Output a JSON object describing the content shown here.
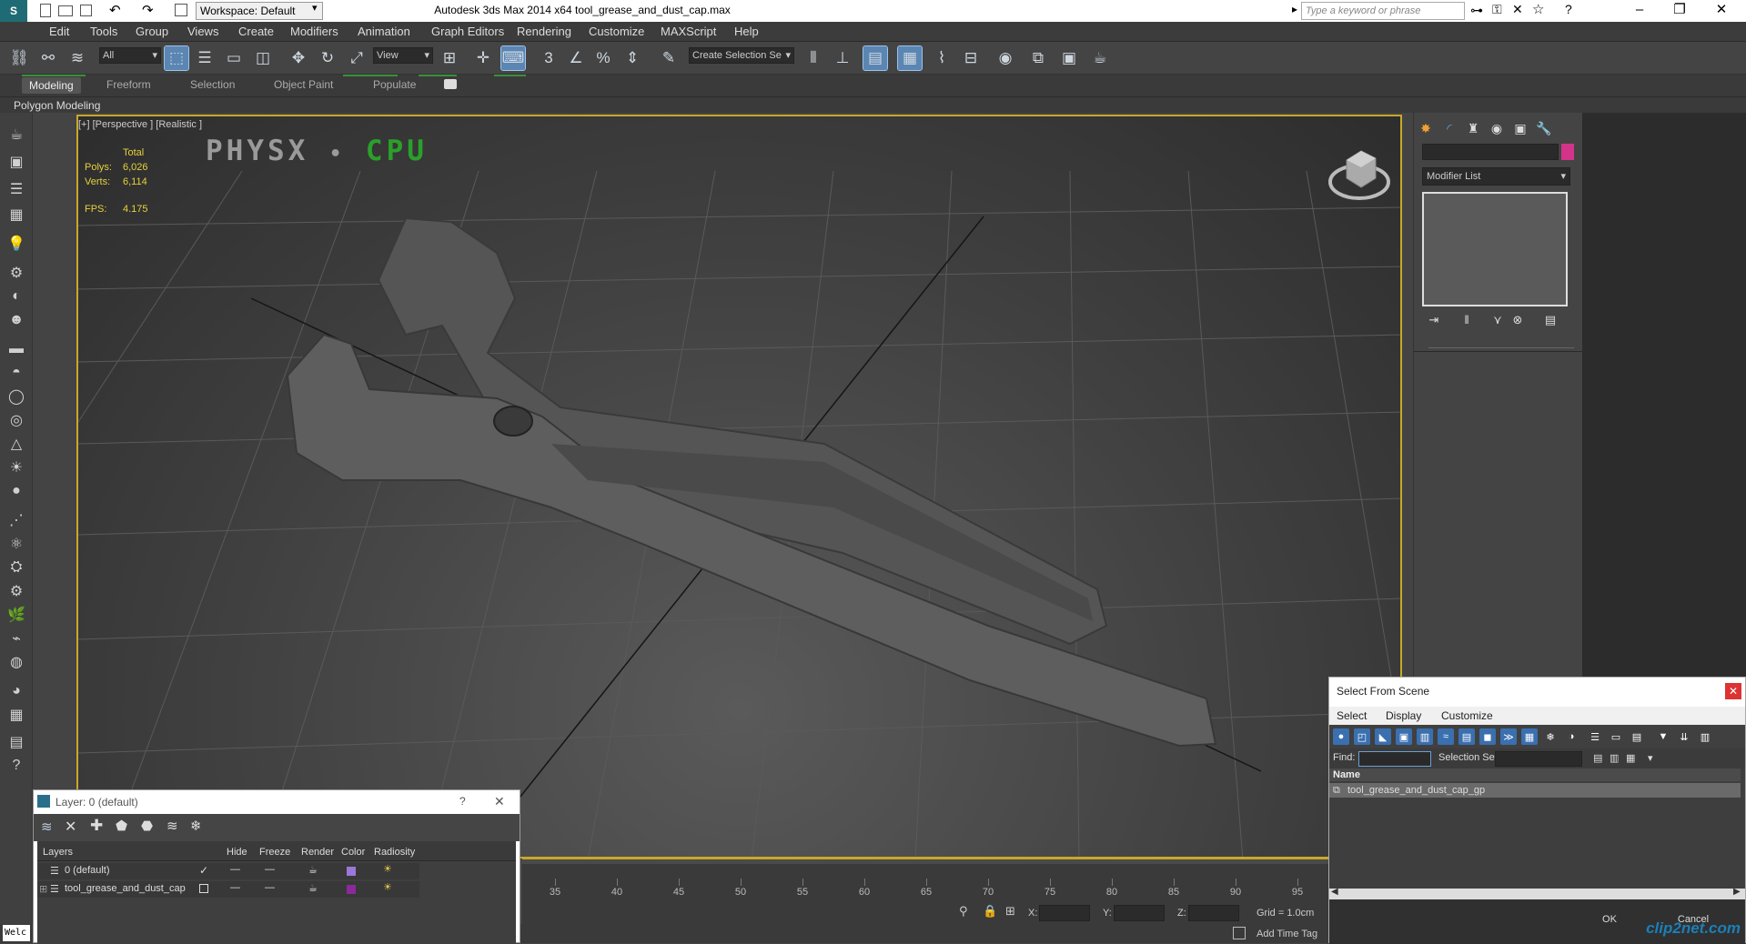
{
  "titlebar": {
    "workspace": "Workspace: Default",
    "app_title": "Autodesk 3ds Max  2014 x64     tool_grease_and_dust_cap.max",
    "search_placeholder": "Type a keyword or phrase"
  },
  "menu": [
    "Edit",
    "Tools",
    "Group",
    "Views",
    "Create",
    "Modifiers",
    "Animation",
    "Graph Editors",
    "Rendering",
    "Customize",
    "MAXScript",
    "Help"
  ],
  "toolbar": {
    "filter": "All",
    "refcoord": "View",
    "selset": "Create Selection Se",
    "snap_label": "3"
  },
  "ribbon": {
    "tabs": [
      "Modeling",
      "Freeform",
      "Selection",
      "Object Paint",
      "Populate"
    ],
    "panel": "Polygon Modeling"
  },
  "viewport": {
    "label": "[+] [Perspective ] [Realistic ]",
    "stats": {
      "total": "Total",
      "polys_label": "Polys:",
      "polys": "6,026",
      "verts_label": "Verts:",
      "verts": "6,114",
      "fps_label": "FPS:",
      "fps": "4.175"
    },
    "physx_a": "PHYSX",
    "physx_sep": "•",
    "physx_b": "CPU"
  },
  "cmdpanel": {
    "modifier_list": "Modifier List",
    "swatch_color": "#d4338a"
  },
  "timeline": {
    "ticks": [
      "35",
      "40",
      "45",
      "50",
      "55",
      "60",
      "65",
      "70",
      "75",
      "80",
      "85",
      "90",
      "95"
    ]
  },
  "status": {
    "x": "X:",
    "y": "Y:",
    "z": "Z:",
    "grid": "Grid = 1.0cm",
    "addtag": "Add Time Tag",
    "welcome": "Welc"
  },
  "layer_dialog": {
    "title": "Layer: 0 (default)",
    "help": "?",
    "close": "✕",
    "headers": [
      "Layers",
      "Hide",
      "Freeze",
      "Render",
      "Color",
      "Radiosity"
    ],
    "rows": [
      {
        "name": "0 (default)",
        "color": "#9a78d8"
      },
      {
        "name": "tool_grease_and_dust_cap",
        "color": "#8a2a9a"
      }
    ]
  },
  "sfs": {
    "title": "Select From Scene",
    "menus": [
      "Select",
      "Display",
      "Customize"
    ],
    "find": "Find:",
    "selection_set": "Selection Set:",
    "column": "Name",
    "row": "tool_grease_and_dust_cap_gp",
    "ok": "OK",
    "cancel": "Cancel"
  },
  "watermark": "clip2net.com"
}
